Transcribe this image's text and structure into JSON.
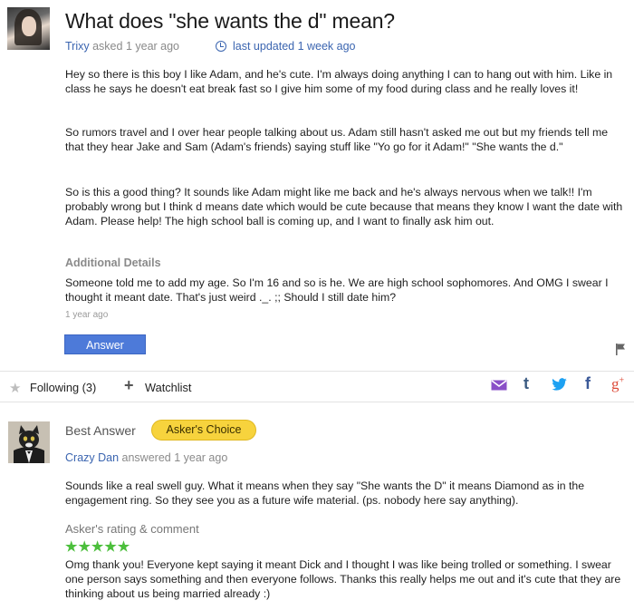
{
  "question": {
    "title": "What does \"she wants the d\" mean?",
    "asker": "Trixy",
    "asked_text": "asked 1 year ago",
    "updated": "last updated 1 week ago",
    "paragraphs": [
      "Hey so there is this boy I like Adam, and he's cute. I'm always doing anything I can to hang out with him. Like in class he says he doesn't eat break fast so I give him some of my food during class and he really loves it!",
      "So rumors travel and I over hear people talking about us. Adam still hasn't asked me out but my friends tell me that they hear Jake and Sam (Adam's friends) saying stuff like \"Yo go for it Adam!\" \"She wants the d.\"",
      "So is this a good thing? It sounds like Adam might like me back and he's always nervous when we talk!! I'm probably wrong but I think d means date which would be cute because that means they know I want the date with Adam. Please help! The high school ball is coming up, and I want to finally ask him out."
    ],
    "additional_label": "Additional Details",
    "additional_text": "Someone told me to add my age. So I'm 16 and so is he. We are high school sophomores. And OMG I swear I thought it meant date. That's just weird ._. ;; Should I still date him?",
    "additional_time": "1 year ago",
    "answer_button": "Answer"
  },
  "toolbar": {
    "following": "Following (3)",
    "watchlist": "Watchlist",
    "share_icons": [
      "mail-icon",
      "tumblr-icon",
      "twitter-icon",
      "facebook-icon",
      "google-plus-icon"
    ],
    "tumblr_glyph": "t",
    "facebook_glyph": "f",
    "gplus_glyph": "g",
    "gplus_sup": "+"
  },
  "best_answer": {
    "label": "Best Answer",
    "badge": "Asker's Choice",
    "answerer": "Crazy Dan",
    "answered_text": "answered 1 year ago",
    "text": "Sounds like a real swell guy. What it means when they say \"She wants the D\" it means Diamond as in the engagement ring. So they see you as a future wife material. (ps. nobody here say anything).",
    "rating_label": "Asker's rating & comment",
    "rating_stars": "★★★★★",
    "rating_value": 5,
    "comment": "Omg thank you! Everyone kept saying it meant Dick and I thought I was like being trolled or something. I swear one person says something and then everyone follows. Thanks this really helps me out and it's cute that they are thinking about us being married already :)"
  },
  "colors": {
    "link": "#3b65b0",
    "button": "#4d7ad9",
    "badge": "#f7d33d",
    "stars": "#4cbf3c"
  }
}
